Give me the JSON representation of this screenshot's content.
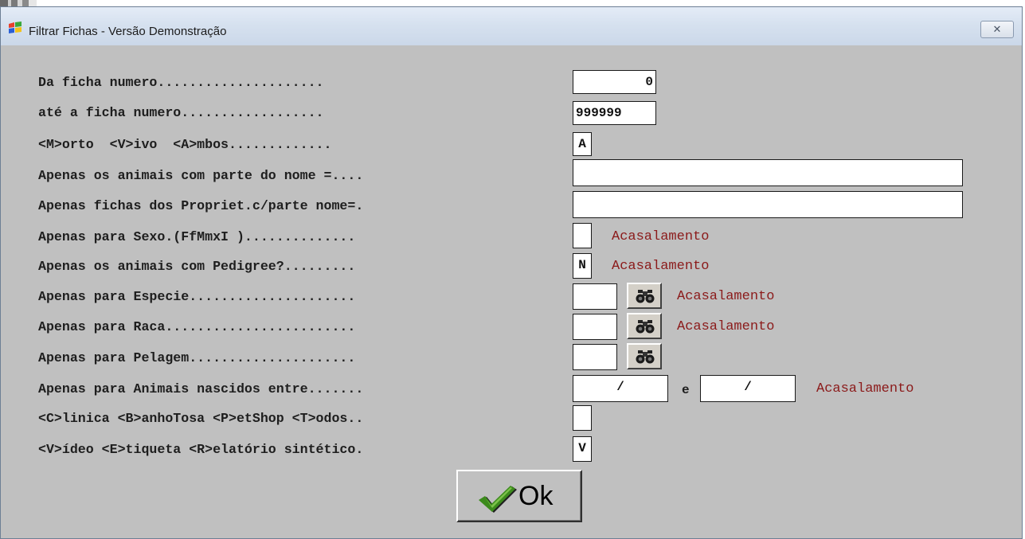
{
  "window": {
    "title": "Filtrar Fichas - Versão Demonstração",
    "close_symbol": "✕",
    "app_icon": "windows-flag-icon"
  },
  "labels": {
    "ficha_de": "Da ficha numero.....................",
    "ficha_ate": "até a ficha numero..................",
    "morto_vivo": "<M>orto  <V>ivo  <A>mbos.............",
    "animais_nome": "Apenas os animais com parte do nome =....",
    "proprietario": "Apenas fichas dos Propriet.c/parte nome=.",
    "sexo": "Apenas para Sexo.(FfMmxI )..............",
    "pedigree": "Apenas os animais com Pedigree?.........",
    "especie": "Apenas para Especie.....................",
    "raca": "Apenas para Raca........................",
    "pelagem": "Apenas para Pelagem.....................",
    "nascidos": "Apenas para Animais nascidos entre.......",
    "clinica": "<C>linica <B>anhoTosa <P>etShop <T>odos..",
    "video": "<V>ídeo <E>tiqueta <R>elatório sintético."
  },
  "values": {
    "ficha_de": "0",
    "ficha_ate": "999999",
    "morto_vivo": "A",
    "animais_nome": "",
    "proprietario": "",
    "sexo": "",
    "pedigree": "N",
    "especie": "",
    "raca": "",
    "pelagem": "",
    "data_inicio": "  /  ",
    "data_fim": "  /  ",
    "clinica": "",
    "video": "V"
  },
  "acasalamento": {
    "sexo": "Acasalamento",
    "pedigree": "Acasalamento",
    "especie": "Acasalamento",
    "raca": "Acasalamento",
    "nascidos": "Acasalamento"
  },
  "date_separator": "e",
  "icons": {
    "search": "binoculars-icon",
    "ok": "checkmark-icon"
  },
  "ok_button": {
    "label": "Ok"
  },
  "colors": {
    "acasalamento": "#8b1a1a",
    "background": "#c0c0c0",
    "checkmark": "#3c8a1c"
  }
}
